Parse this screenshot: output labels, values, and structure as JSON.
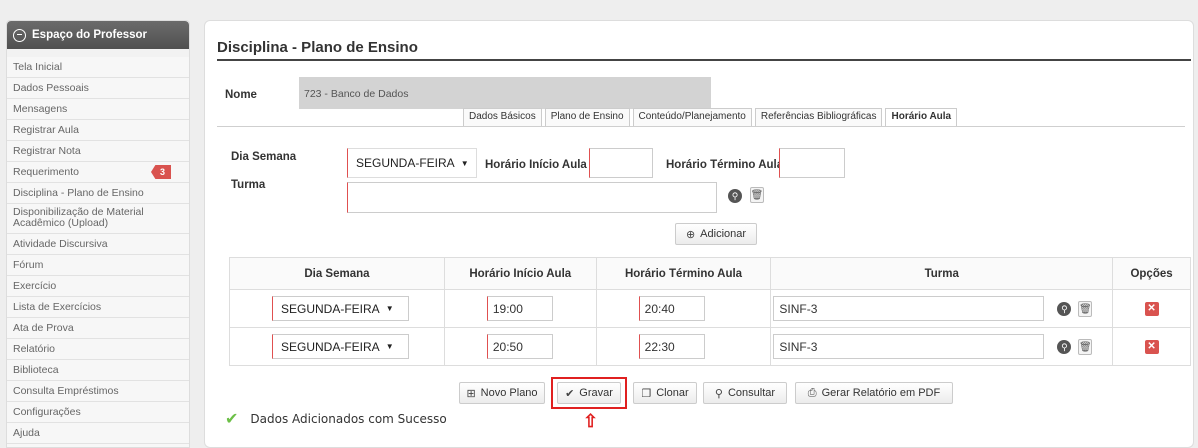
{
  "sidebar": {
    "title": "Espaço do Professor",
    "items": [
      {
        "label": "Tela Inicial"
      },
      {
        "label": "Dados Pessoais"
      },
      {
        "label": "Mensagens"
      },
      {
        "label": "Registrar Aula"
      },
      {
        "label": "Registrar Nota"
      },
      {
        "label": "Requerimento",
        "badge": "3"
      },
      {
        "label": "Disciplina - Plano de Ensino"
      },
      {
        "label": "Disponibilização de Material Acadêmico (Upload)"
      },
      {
        "label": "Atividade Discursiva"
      },
      {
        "label": "Fórum"
      },
      {
        "label": "Exercício"
      },
      {
        "label": "Lista de Exercícios"
      },
      {
        "label": "Ata de Prova"
      },
      {
        "label": "Relatório"
      },
      {
        "label": "Biblioteca"
      },
      {
        "label": "Consulta Empréstimos"
      },
      {
        "label": "Configurações"
      },
      {
        "label": "Ajuda"
      }
    ]
  },
  "page": {
    "title": "Disciplina - Plano de Ensino",
    "nome_label": "Nome",
    "nome_value": "723 - Banco de Dados"
  },
  "tabs": [
    {
      "label": "Dados Básicos"
    },
    {
      "label": "Plano de Ensino"
    },
    {
      "label": "Conteúdo/Planejamento"
    },
    {
      "label": "Referências Bibliográficas"
    },
    {
      "label": "Horário Aula",
      "active": true
    }
  ],
  "form": {
    "dia_semana_label": "Dia Semana",
    "dia_semana_value": "SEGUNDA-FEIRA",
    "inicio_label": "Horário Início Aula",
    "inicio_value": "",
    "termino_label": "Horário Término Aula",
    "termino_value": "",
    "turma_label": "Turma",
    "turma_value": "",
    "adicionar_label": "Adicionar"
  },
  "table": {
    "headers": [
      "Dia Semana",
      "Horário Início Aula",
      "Horário Término Aula",
      "Turma",
      "Opções"
    ],
    "rows": [
      {
        "dia": "SEGUNDA-FEIRA",
        "inicio": "19:00",
        "termino": "20:40",
        "turma": "SINF-3"
      },
      {
        "dia": "SEGUNDA-FEIRA",
        "inicio": "20:50",
        "termino": "22:30",
        "turma": "SINF-3"
      }
    ]
  },
  "actions": {
    "novo_plano": "Novo Plano",
    "gravar": "Gravar",
    "clonar": "Clonar",
    "consultar": "Consultar",
    "gerar_pdf": "Gerar Relatório em PDF"
  },
  "status": {
    "message": "Dados Adicionados com Sucesso"
  },
  "colors": {
    "highlight": "#e02020",
    "badge": "#d9534f",
    "success": "#6cbf47"
  }
}
